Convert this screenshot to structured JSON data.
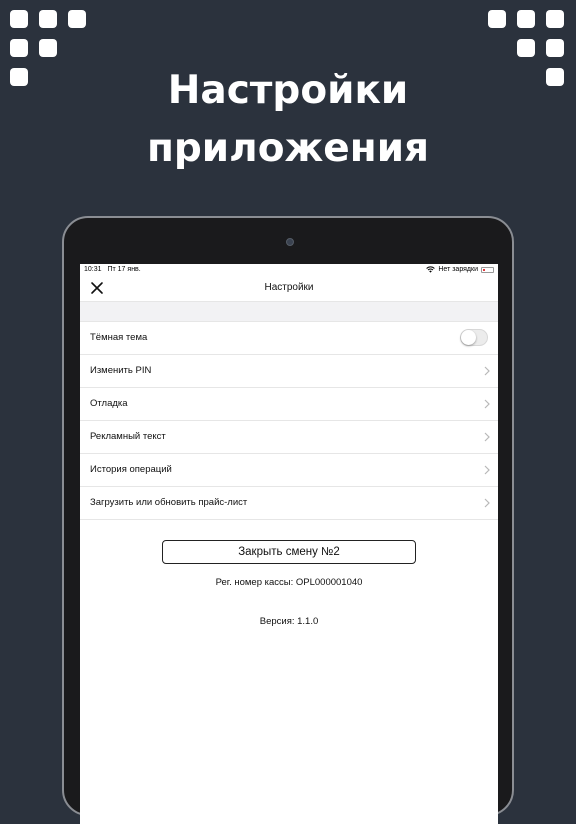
{
  "headline": {
    "line1": "Настройки",
    "line2": "приложения"
  },
  "status_bar": {
    "time": "10:31",
    "date": "Пт 17 янв.",
    "charging": "Нет зарядки"
  },
  "nav": {
    "title": "Настройки",
    "close_icon": "close-icon"
  },
  "settings": {
    "dark_theme": {
      "label": "Тёмная тема",
      "enabled": false
    },
    "items": [
      {
        "label": "Изменить PIN",
        "icon": "chevron-right-icon"
      },
      {
        "label": "Отладка",
        "icon": "chevron-right-icon"
      },
      {
        "label": "Рекламный текст",
        "icon": "chevron-right-icon"
      },
      {
        "label": "История операций",
        "icon": "chevron-right-icon"
      },
      {
        "label": "Загрузить или обновить прайс-лист",
        "icon": "chevron-right-icon"
      }
    ]
  },
  "footer": {
    "close_shift_label": "Закрыть смену №2",
    "reg_number": "Рег. номер кассы: OPL000001040",
    "version": "Версия: 1.1.0"
  },
  "colors": {
    "background": "#2b323d",
    "decor_squares": "#ffffff",
    "screen": "#ffffff",
    "section_gap": "#f2f2f4",
    "separator": "#e6e6e6"
  }
}
